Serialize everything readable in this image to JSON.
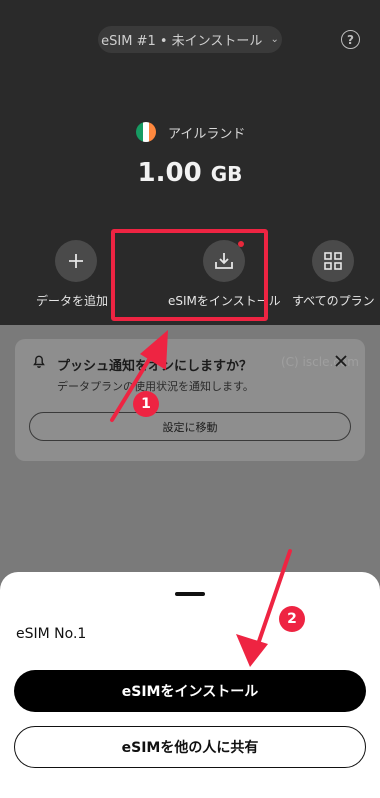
{
  "header": {
    "esim_selector": "eSIM #1 • 未インストール",
    "help_icon": "?"
  },
  "plan": {
    "country": "アイルランド",
    "data_value": "1.00",
    "data_unit": "GB",
    "flag_colors": [
      "#169b62",
      "#ffffff",
      "#ff883e"
    ]
  },
  "actions": [
    {
      "label": "データを追加",
      "icon": "plus-icon"
    },
    {
      "label": "eSIMをインストール",
      "icon": "download-icon"
    },
    {
      "label": "すべてのプラン",
      "icon": "grid-icon"
    }
  ],
  "notification": {
    "title": "プッシュ通知をオンにしますか？",
    "description": "データプランの使用状況を通知します。",
    "button": "設定に移動",
    "watermark": "(C) iscle.com"
  },
  "sheet": {
    "title": "eSIM No.1",
    "primary_button": "eSIMをインストール",
    "secondary_button": "eSIMを他の人に共有"
  },
  "annotations": {
    "step1": "1",
    "step2": "2",
    "color": "#ee2442"
  }
}
